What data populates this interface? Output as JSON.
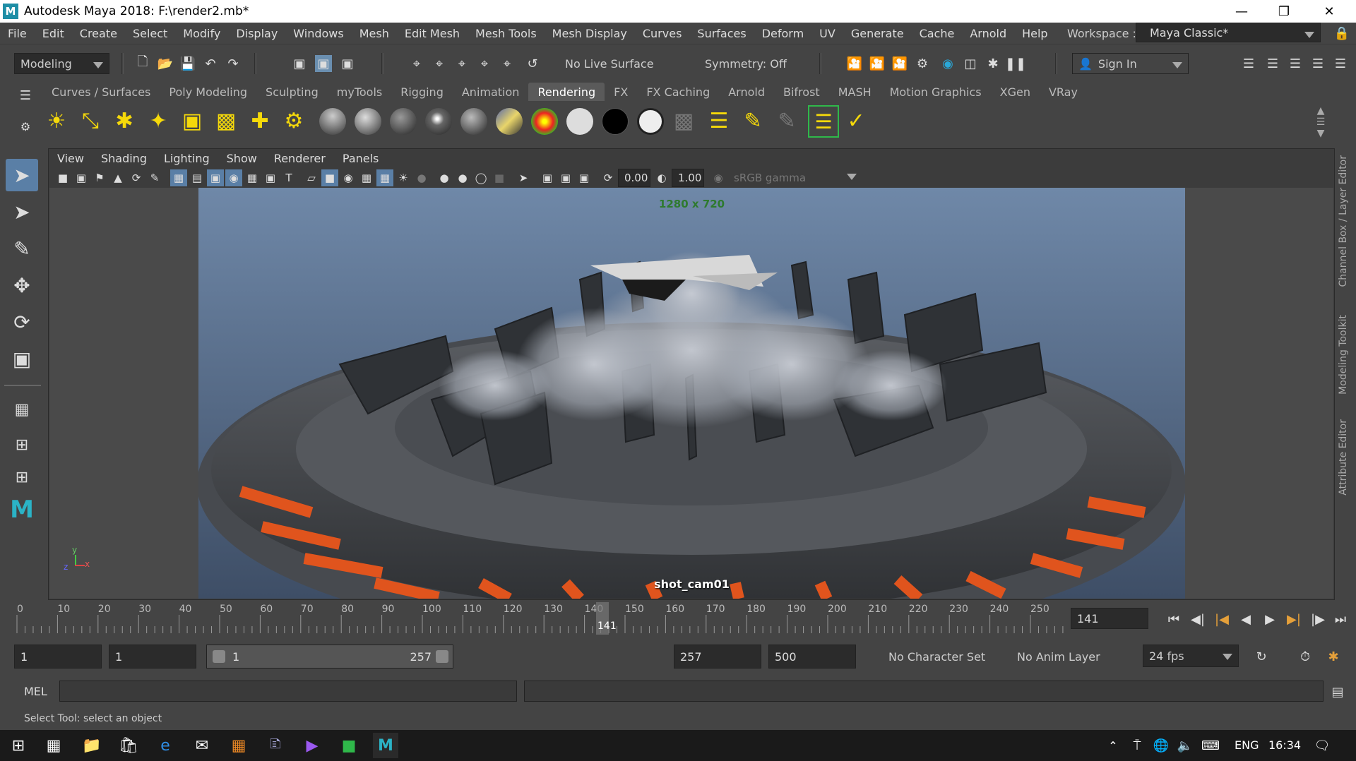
{
  "window": {
    "title": "Autodesk Maya 2018: F:\\render2.mb*",
    "logo": "M"
  },
  "menus": [
    "File",
    "Edit",
    "Create",
    "Select",
    "Modify",
    "Display",
    "Windows",
    "Mesh",
    "Edit Mesh",
    "Mesh Tools",
    "Mesh Display",
    "Curves",
    "Surfaces",
    "Deform",
    "UV",
    "Generate",
    "Cache",
    "Arnold",
    "Help"
  ],
  "workspace": {
    "label": "Workspace :",
    "value": "Maya Classic*"
  },
  "statusline": {
    "mode": "Modeling",
    "live_surface": "No Live Surface",
    "symmetry": "Symmetry: Off",
    "sign_in": "Sign In"
  },
  "shelf_tabs": [
    "Curves / Surfaces",
    "Poly Modeling",
    "Sculpting",
    "myTools",
    "Rigging",
    "Animation",
    "Rendering",
    "FX",
    "FX Caching",
    "Arnold",
    "Bifrost",
    "MASH",
    "Motion Graphics",
    "XGen",
    "VRay"
  ],
  "active_shelf": "Rendering",
  "panel_menus": [
    "View",
    "Shading",
    "Lighting",
    "Show",
    "Renderer",
    "Panels"
  ],
  "panel_toolbar": {
    "exposure": "0.00",
    "gamma": "1.00",
    "color_space": "sRGB gamma"
  },
  "viewport": {
    "resolution": "1280 x 720",
    "camera": "shot_cam01",
    "axis_y": "y",
    "axis_x": "x",
    "axis_z": "z"
  },
  "side_tabs": [
    "Channel Box / Layer Editor",
    "Modeling Toolkit",
    "Attribute Editor"
  ],
  "timeline": {
    "ticks": [
      "0",
      "10",
      "20",
      "30",
      "40",
      "50",
      "60",
      "70",
      "80",
      "90",
      "100",
      "110",
      "120",
      "130",
      "140",
      "150",
      "160",
      "170",
      "180",
      "190",
      "200",
      "210",
      "220",
      "230",
      "240",
      "250"
    ],
    "current_frame": "141",
    "current_frame_field": "141"
  },
  "range": {
    "start": "1",
    "playback_start": "1",
    "slider_start": "1",
    "slider_end": "257",
    "playback_end": "257",
    "end": "500",
    "character_set": "No Character Set",
    "anim_layer": "No Anim Layer",
    "fps": "24 fps"
  },
  "command": {
    "lang": "MEL"
  },
  "help_line": "Select Tool: select an object",
  "tray": {
    "language": "ENG",
    "time": "16:34"
  },
  "colors": {
    "accent_orange": "#e0541d",
    "active_green": "#2fb84a",
    "maya_blue": "#1e8ea6"
  }
}
